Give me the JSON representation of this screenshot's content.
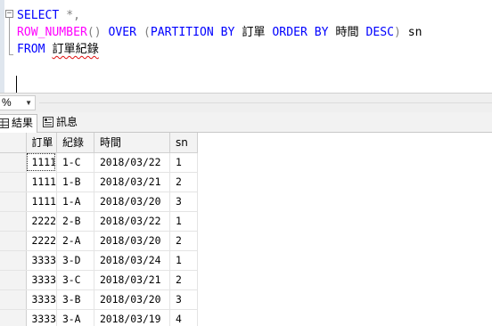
{
  "editor": {
    "fold_symbol": "−",
    "lines": [
      {
        "kw_select": "SELECT",
        "star": " *,",
        "trail": ""
      },
      {
        "fn_row_number": "ROW_NUMBER",
        "parens": "()",
        "kw_over": "OVER",
        "open": "(",
        "kw_partition_by": "PARTITION BY",
        "col_order": "訂單",
        "kw_order_by": "ORDER BY",
        "col_time": "時間",
        "kw_desc": "DESC",
        "close": ")",
        "alias": "sn"
      },
      {
        "kw_from": "FROM",
        "table": "訂單紀錄"
      }
    ]
  },
  "zoom": {
    "value": "%"
  },
  "tabs": [
    {
      "label": "結果"
    },
    {
      "label": "訊息"
    }
  ],
  "grid": {
    "columns": [
      "訂單",
      "紀錄",
      "時間",
      "sn"
    ],
    "rows": [
      [
        "1111",
        "1-C",
        "2018/03/22",
        "1"
      ],
      [
        "1111",
        "1-B",
        "2018/03/21",
        "2"
      ],
      [
        "1111",
        "1-A",
        "2018/03/20",
        "3"
      ],
      [
        "2222",
        "2-B",
        "2018/03/22",
        "1"
      ],
      [
        "2222",
        "2-A",
        "2018/03/20",
        "2"
      ],
      [
        "3333",
        "3-D",
        "2018/03/24",
        "1"
      ],
      [
        "3333",
        "3-C",
        "2018/03/21",
        "2"
      ],
      [
        "3333",
        "3-B",
        "2018/03/20",
        "3"
      ],
      [
        "3333",
        "3-A",
        "2018/03/19",
        "4"
      ]
    ]
  },
  "colors": {
    "keyword": "#0000ff",
    "function": "#ff00ff",
    "operator": "#808080",
    "squiggle": "#e01010"
  }
}
